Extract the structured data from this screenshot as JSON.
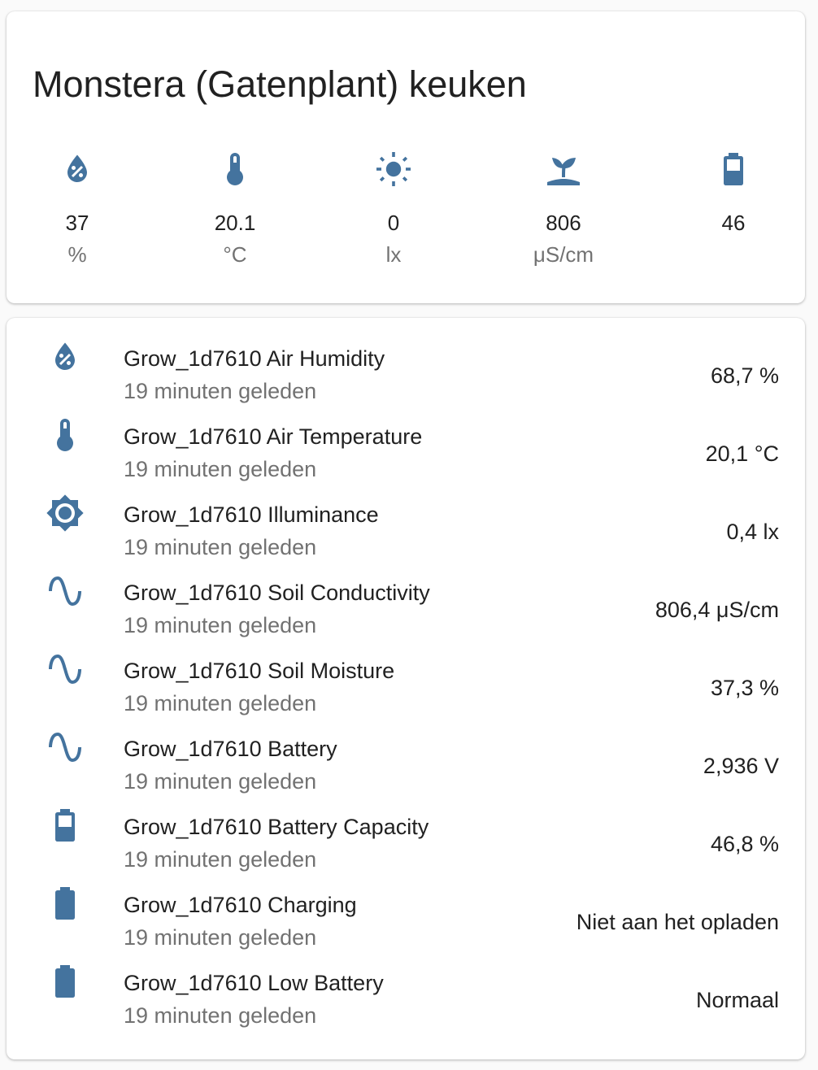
{
  "card": {
    "title": "Monstera (Gatenplant) keuken"
  },
  "sensors": [
    {
      "icon": "water-percent-icon",
      "value": "37",
      "unit": "%"
    },
    {
      "icon": "thermometer-icon",
      "value": "20.1",
      "unit": "°C"
    },
    {
      "icon": "white-balance-sunny-icon",
      "value": "0",
      "unit": "lx"
    },
    {
      "icon": "sprout-icon",
      "value": "806",
      "unit": "μS/cm"
    },
    {
      "icon": "battery-icon",
      "value": "46",
      "unit": ""
    }
  ],
  "entities": [
    {
      "icon": "water-percent-icon",
      "name": "Grow_1d7610 Air Humidity",
      "time": "19 minuten geleden",
      "value": "68,7 %"
    },
    {
      "icon": "thermometer-icon",
      "name": "Grow_1d7610 Air Temperature",
      "time": "19 minuten geleden",
      "value": "20,1 °C"
    },
    {
      "icon": "brightness-icon",
      "name": "Grow_1d7610 Illuminance",
      "time": "19 minuten geleden",
      "value": "0,4 lx"
    },
    {
      "icon": "sine-wave-icon",
      "name": "Grow_1d7610 Soil Conductivity",
      "time": "19 minuten geleden",
      "value": "806,4 μS/cm"
    },
    {
      "icon": "sine-wave-icon",
      "name": "Grow_1d7610 Soil Moisture",
      "time": "19 minuten geleden",
      "value": "37,3 %"
    },
    {
      "icon": "sine-wave-icon",
      "name": "Grow_1d7610 Battery",
      "time": "19 minuten geleden",
      "value": "2,936 V"
    },
    {
      "icon": "battery-50-icon",
      "name": "Grow_1d7610 Battery Capacity",
      "time": "19 minuten geleden",
      "value": "46,8 %"
    },
    {
      "icon": "battery-icon",
      "name": "Grow_1d7610 Charging",
      "time": "19 minuten geleden",
      "value": "Niet aan het opladen"
    },
    {
      "icon": "battery-icon",
      "name": "Grow_1d7610 Low Battery",
      "time": "19 minuten geleden",
      "value": "Normaal"
    }
  ],
  "colors": {
    "icon": "#44739e",
    "primary_text": "#212121",
    "secondary_text": "#727272",
    "card_background": "#ffffff",
    "page_background": "#fafafa"
  }
}
